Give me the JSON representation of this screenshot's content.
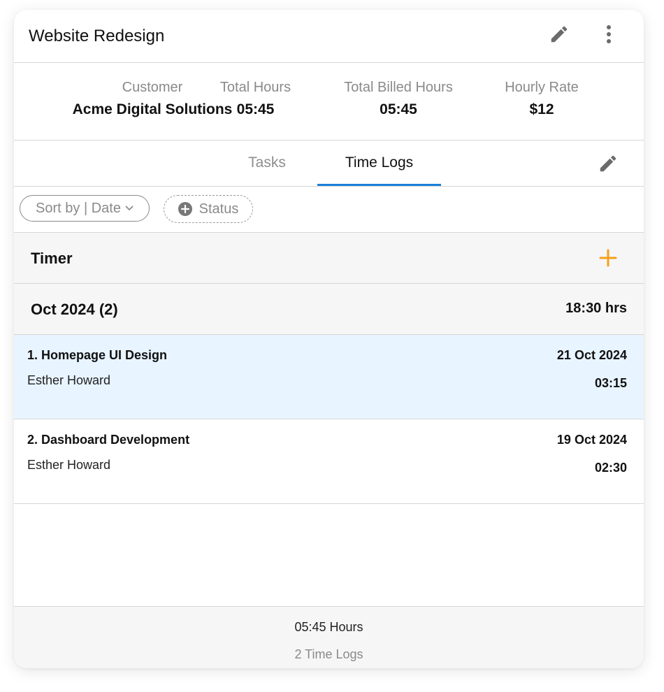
{
  "header": {
    "title": "Website Redesign",
    "edit_icon": "pencil-icon",
    "more_icon": "more-vertical-icon"
  },
  "stats": [
    {
      "label": "Customer",
      "value": "Acme Digital Solutions"
    },
    {
      "label": "Total Hours",
      "value": "05:45"
    },
    {
      "label": "Total Billed Hours",
      "value": "05:45"
    },
    {
      "label": "Hourly Rate",
      "value": "$12"
    }
  ],
  "tabs": [
    {
      "label": "Tasks",
      "active": false
    },
    {
      "label": "Time Logs",
      "active": true
    }
  ],
  "filters": {
    "sort_label": "Sort by | Date",
    "status_label": "Status"
  },
  "timer": {
    "label": "Timer",
    "add_icon": "plus-icon"
  },
  "group": {
    "label": "Oct 2024 (2)",
    "total": "18:30 hrs"
  },
  "logs": [
    {
      "name": "1. Homepage UI Design",
      "person": "Esther Howard",
      "date": "21 Oct 2024",
      "duration": "03:15",
      "selected": true
    },
    {
      "name": "2. Dashboard Development",
      "person": "Esther Howard",
      "date": "19 Oct 2024",
      "duration": "02:30",
      "selected": false
    }
  ],
  "footer": {
    "hours": "05:45 Hours",
    "count": "2 Time Logs"
  },
  "colors": {
    "accent_blue": "#1a7fd8",
    "add_orange": "#f5a01a",
    "selected_row": "#e8f4ff"
  }
}
